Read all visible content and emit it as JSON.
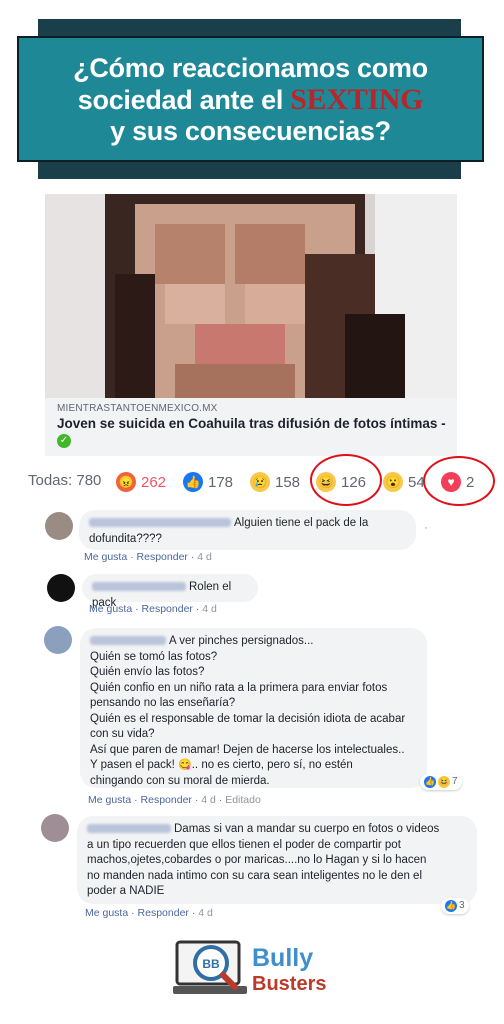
{
  "banner": {
    "line1": "¿Cómo reaccionamos como",
    "line2_pre": "sociedad ante el ",
    "line2_hl": "SEXTING",
    "line3": "y sus consecuencias?"
  },
  "post": {
    "domain": "MIENTRASTANTOENMEXICO.MX",
    "headline": "Joven se suicida en Coahuila tras difusión de fotos íntimas -"
  },
  "reactions": {
    "all_label": "Todas: 780",
    "items": [
      {
        "icon": "angry-icon",
        "count": "262",
        "color": "#f25268"
      },
      {
        "icon": "like-icon",
        "count": "178",
        "color": "#606770"
      },
      {
        "icon": "sad-icon",
        "count": "158",
        "color": "#606770"
      },
      {
        "icon": "haha-icon",
        "count": "126",
        "color": "#606770"
      },
      {
        "icon": "wow-icon",
        "count": "54",
        "color": "#606770"
      },
      {
        "icon": "love-icon",
        "count": "2",
        "color": "#606770"
      }
    ]
  },
  "comments": [
    {
      "text1": "Alguien tiene el pack de la",
      "text2": "dofundita????",
      "like": "Me gusta",
      "reply": "Responder",
      "time": "4 d"
    },
    {
      "text1": "Rolen el pack",
      "like": "Me gusta",
      "reply": "Responder",
      "time": "4 d"
    },
    {
      "lines": [
        "A ver pinches persignados...",
        "Quién se tomó las fotos?",
        "Quién envío las fotos?",
        "Quién confio en un niño rata a la primera para enviar fotos",
        "pensando no las enseñaría?",
        "Quién es el responsable de tomar la decisión idiota de acabar",
        "con su vida?",
        "Así que paren de mamar! Dejen de hacerse los intelectuales..",
        "Y pasen el pack!",
        ".. no es cierto, pero sí, no estén",
        "chingando con su moral de mierda."
      ],
      "reaction_count": "7",
      "like": "Me gusta",
      "reply": "Responder",
      "time": "4 d",
      "edited": "Editado"
    },
    {
      "lines": [
        "Damas si van a mandar su cuerpo en fotos o videos",
        "a un tipo recuerden que ellos tienen el poder de compartir pot",
        "machos,ojetes,cobardes o por maricas....no lo Hagan y si lo hacen",
        "no manden nada intimo con su cara sean inteligentes no le den el",
        "poder a NADIE"
      ],
      "reaction_count": "3",
      "like": "Me gusta",
      "reply": "Responder",
      "time": "4 d"
    }
  ],
  "logo": {
    "badge": "BB",
    "word1": "Bully",
    "word2": "Busters"
  }
}
